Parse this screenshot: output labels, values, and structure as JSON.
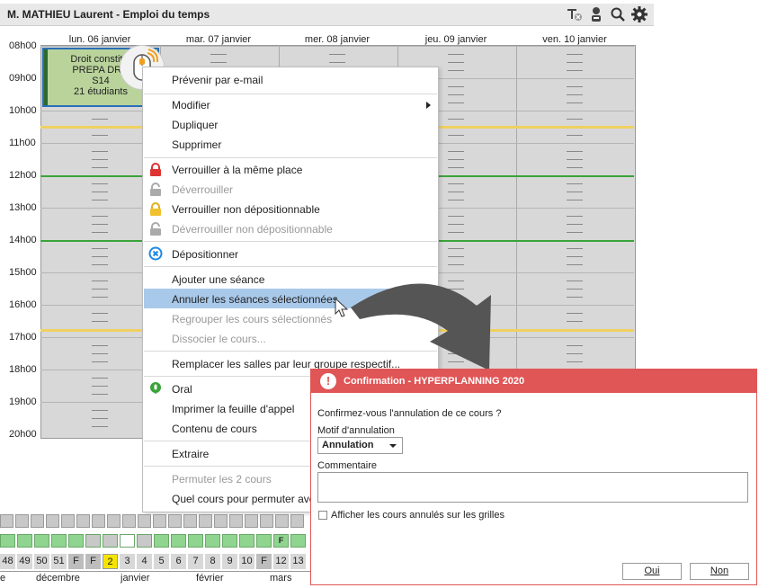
{
  "window": {
    "title": "M. MATHIEU Laurent - Emploi du temps"
  },
  "toolbar_icons": [
    "filter-clear-icon",
    "person-icon",
    "search-icon",
    "gear-icon"
  ],
  "days": [
    "lun. 06 janvier",
    "mar. 07 janvier",
    "mer. 08 janvier",
    "jeu. 09 janvier",
    "ven. 10 janvier"
  ],
  "hours": [
    "08h00",
    "09h00",
    "10h00",
    "11h00",
    "12h00",
    "13h00",
    "14h00",
    "15h00",
    "16h00",
    "17h00",
    "18h00",
    "19h00",
    "20h00"
  ],
  "course": {
    "line1": "Droit constitut",
    "line2": "PREPA DRO",
    "line3": "S14",
    "line4": "21 étudiants"
  },
  "context_menu": {
    "items": [
      {
        "label": "Prévenir par e-mail",
        "enabled": true
      },
      {
        "label": "Modifier",
        "enabled": true,
        "submenu": true
      },
      {
        "label": "Dupliquer",
        "enabled": true
      },
      {
        "label": "Supprimer",
        "enabled": true
      },
      {
        "label": "Verrouiller à la même place",
        "enabled": true,
        "icon": "lock-red-icon"
      },
      {
        "label": "Déverrouiller",
        "enabled": false,
        "icon": "unlock-gray-icon"
      },
      {
        "label": "Verrouiller non dépositionnable",
        "enabled": true,
        "icon": "lock-yellow-icon"
      },
      {
        "label": "Déverrouiller non dépositionnable",
        "enabled": false,
        "icon": "unlock-gray-icon"
      },
      {
        "label": "Dépositionner",
        "enabled": true,
        "icon": "x-circle-icon"
      },
      {
        "label": "Ajouter une séance",
        "enabled": true
      },
      {
        "label": "Annuler les séances sélectionnées",
        "enabled": true,
        "highlighted": true
      },
      {
        "label": "Regrouper les cours sélectionnés",
        "enabled": false
      },
      {
        "label": "Dissocier le cours...",
        "enabled": false
      },
      {
        "label": "Remplacer les salles par leur groupe respectif...",
        "enabled": true
      },
      {
        "label": "Oral",
        "enabled": true,
        "icon": "oral-icon"
      },
      {
        "label": "Imprimer la feuille d'appel",
        "enabled": true
      },
      {
        "label": "Contenu de cours",
        "enabled": true
      },
      {
        "label": "Extraire",
        "enabled": true
      },
      {
        "label": "Permuter les 2 cours",
        "enabled": false
      },
      {
        "label": "Quel cours pour permuter ave",
        "enabled": true
      }
    ]
  },
  "week_bar": {
    "numbers": [
      "48",
      "49",
      "50",
      "51",
      "F",
      "F",
      "2",
      "3",
      "4",
      "5",
      "6",
      "7",
      "8",
      "9",
      "10",
      "F",
      "12",
      "13"
    ],
    "current_week": "2",
    "marker_f": "F",
    "months": [
      "e",
      "décembre",
      "janvier",
      "février",
      "mars"
    ]
  },
  "dialog": {
    "title": "Confirmation - HYPERPLANNING 2020",
    "question": "Confirmez-vous l'annulation de ce cours ?",
    "motif_label": "Motif d'annulation",
    "motif_value": "Annulation",
    "comment_label": "Commentaire",
    "checkbox_label": "Afficher les cours annulés sur les grilles",
    "ok": "Oui",
    "cancel": "Non"
  },
  "colors": {
    "accent_red": "#e05556",
    "course_green": "#b9d39b",
    "highlight": "#a9c9ea"
  }
}
